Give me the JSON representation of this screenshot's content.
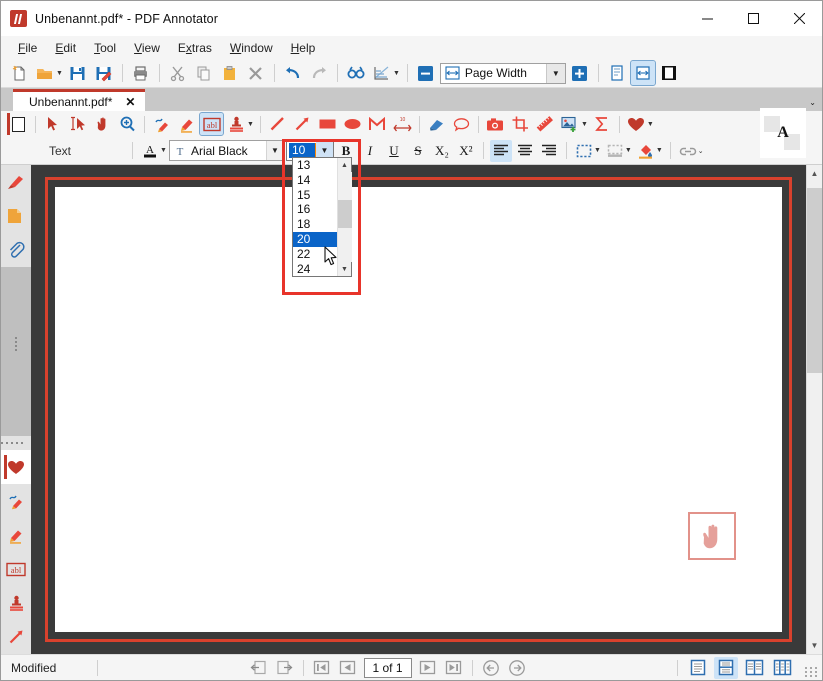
{
  "window": {
    "title": "Unbenannt.pdf* - PDF Annotator",
    "logo_icon": "pdf-annotator-logo-icon",
    "controls": {
      "minimize": "—",
      "maximize": "□",
      "close": "✕"
    }
  },
  "menubar": {
    "items": [
      {
        "label": "File",
        "accel": "F"
      },
      {
        "label": "Edit",
        "accel": "E"
      },
      {
        "label": "Tool",
        "accel": "T"
      },
      {
        "label": "View",
        "accel": "V"
      },
      {
        "label": "Extras",
        "accel": "x"
      },
      {
        "label": "Window",
        "accel": "W"
      },
      {
        "label": "Help",
        "accel": "H"
      }
    ]
  },
  "toolbar": {
    "buttons": [
      {
        "name": "new-document-icon",
        "title": "New"
      },
      {
        "name": "open-document-icon",
        "title": "Open"
      },
      {
        "name": "save-icon",
        "title": "Save"
      },
      {
        "name": "save-as-icon",
        "title": "Save As"
      },
      {
        "name": "print-icon",
        "title": "Print"
      },
      {
        "name": "cut-icon",
        "title": "Cut"
      },
      {
        "name": "copy-icon",
        "title": "Copy"
      },
      {
        "name": "paste-icon",
        "title": "Paste"
      },
      {
        "name": "delete-icon",
        "title": "Delete"
      },
      {
        "name": "undo-icon",
        "title": "Undo"
      },
      {
        "name": "redo-icon",
        "title": "Redo"
      },
      {
        "name": "find-icon",
        "title": "Find"
      },
      {
        "name": "chart-tool-icon",
        "title": "Presentation"
      }
    ],
    "zoom": {
      "out_label": "–",
      "in_label": "+",
      "value": "Page Width",
      "icon": "page-width-icon",
      "arrow": "⌄"
    },
    "view_modes": [
      {
        "name": "fit-page-icon",
        "active": false
      },
      {
        "name": "fit-width-icon",
        "active": true
      },
      {
        "name": "full-screen-icon",
        "active": false
      }
    ]
  },
  "document_tab": {
    "label": "Unbenannt.pdf*",
    "close_label": "✕",
    "overflow_arrow": "⌄"
  },
  "tools_row": {
    "tools": [
      {
        "name": "select-arrow-icon",
        "active": false
      },
      {
        "name": "text-select-icon",
        "active": false
      },
      {
        "name": "hand-pan-icon",
        "active": false
      },
      {
        "name": "zoom-in-tool-icon",
        "active": false
      },
      {
        "name": "pen-tool-icon",
        "active": false
      },
      {
        "name": "highlighter-tool-icon",
        "active": false
      },
      {
        "name": "text-tool-icon",
        "active": true
      },
      {
        "name": "stamp-tool-icon",
        "active": false
      },
      {
        "name": "line-tool-icon",
        "active": false
      },
      {
        "name": "arrow-tool-icon",
        "active": false
      },
      {
        "name": "rectangle-tool-icon",
        "active": false
      },
      {
        "name": "ellipse-tool-icon",
        "active": false
      },
      {
        "name": "polygon-tool-icon",
        "active": false
      },
      {
        "name": "measure-tool-icon",
        "active": false
      },
      {
        "name": "eraser-tool-icon",
        "active": false
      },
      {
        "name": "comment-tool-icon",
        "active": false
      },
      {
        "name": "snapshot-tool-icon",
        "active": false
      },
      {
        "name": "crop-tool-icon",
        "active": false
      },
      {
        "name": "ruler-tool-icon",
        "active": false
      },
      {
        "name": "insert-image-icon",
        "active": false
      },
      {
        "name": "formula-tool-icon",
        "active": false
      },
      {
        "name": "favorites-heart-icon",
        "active": false
      }
    ],
    "measure_badge": "10"
  },
  "format_row": {
    "label": "Text",
    "font_color_icon": "font-color-icon",
    "font": {
      "name": "Arial Black",
      "arrow": "⌄"
    },
    "size": {
      "value": "10",
      "arrow": "⌄",
      "options": [
        "13",
        "14",
        "15",
        "16",
        "18",
        "20",
        "22",
        "24"
      ],
      "selected": "20",
      "scroll_up": "˄",
      "scroll_down": "˅"
    },
    "style_buttons": [
      {
        "name": "bold-button",
        "label": "B"
      },
      {
        "name": "italic-button",
        "label": "I"
      },
      {
        "name": "underline-button",
        "label": "U"
      },
      {
        "name": "strikethrough-button",
        "label": "S"
      },
      {
        "name": "subscript-button",
        "label": "X₂"
      },
      {
        "name": "superscript-button",
        "label": "X²"
      }
    ],
    "align_buttons": [
      {
        "name": "align-left-button",
        "active": true
      },
      {
        "name": "align-center-button",
        "active": false
      },
      {
        "name": "align-right-button",
        "active": false
      }
    ],
    "extras": [
      {
        "name": "border-style-button"
      },
      {
        "name": "shading-style-button"
      },
      {
        "name": "fill-color-button"
      },
      {
        "name": "hyperlink-button"
      }
    ],
    "overflow_arrow": "⌄"
  },
  "cursor_preview": {
    "glyph": "A",
    "name": "text-cursor-preview"
  },
  "left_rail": {
    "top_tabs": [
      {
        "name": "sidebar-tab-bookmarks",
        "icon": "bookmark-pin-icon",
        "selected": false
      },
      {
        "name": "sidebar-tab-pages",
        "icon": "pages-folder-icon",
        "selected": false
      },
      {
        "name": "sidebar-tab-attachments",
        "icon": "paperclip-icon",
        "selected": false
      }
    ],
    "bottom_tabs": [
      {
        "name": "sidebar-tab-favorites",
        "icon": "heart-icon",
        "selected": true
      },
      {
        "name": "sidebar-tab-pen",
        "icon": "pen-icon",
        "selected": false
      },
      {
        "name": "sidebar-tab-highlighter",
        "icon": "highlighter-icon",
        "selected": false
      },
      {
        "name": "sidebar-tab-text",
        "icon": "text-abl-icon",
        "selected": false
      },
      {
        "name": "sidebar-tab-stamp",
        "icon": "stamp-icon",
        "selected": false
      },
      {
        "name": "sidebar-tab-arrow",
        "icon": "arrow-icon",
        "selected": false
      }
    ]
  },
  "page_area": {
    "hand_widget_icon": "hand-pan-widget-icon"
  },
  "statusbar": {
    "status": "Modified",
    "nav": {
      "prev_view_icon": "previous-view-icon",
      "next_view_icon": "next-view-icon",
      "first_page_icon": "first-page-icon",
      "prev_page_icon": "previous-page-icon",
      "page_value": "1 of 1",
      "next_page_icon": "next-page-icon",
      "last_page_icon": "last-page-icon",
      "back_icon": "history-back-icon",
      "forward_icon": "history-forward-icon"
    },
    "layout_modes": [
      {
        "name": "layout-single-page",
        "active": false
      },
      {
        "name": "layout-continuous",
        "active": true
      },
      {
        "name": "layout-facing",
        "active": false
      },
      {
        "name": "layout-continuous-facing",
        "active": false
      }
    ]
  },
  "colors": {
    "accent_red": "#c0392b",
    "highlight_blue": "#0a64c8",
    "tool_blue": "#1f6fb5",
    "page_border_red": "#d9412d",
    "annotation_red": "#e8342a"
  }
}
